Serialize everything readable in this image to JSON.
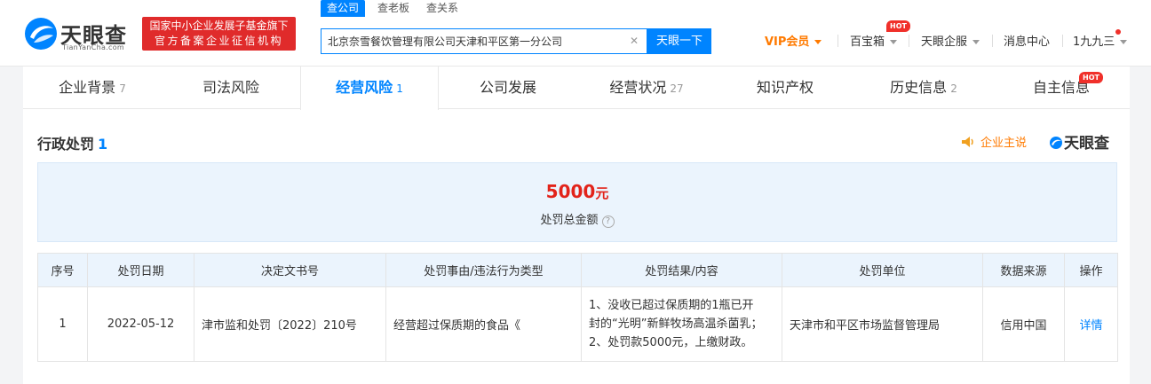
{
  "header": {
    "logo_text": "天眼查",
    "logo_domain": "TianYanCha.com",
    "gov_line1": "国家中小企业发展子基金旗下",
    "gov_line2": "官方备案企业征信机构",
    "search_tabs": [
      "查公司",
      "查老板",
      "查关系"
    ],
    "search_value": "北京奈雪餐饮管理有限公司天津和平区第一分公司",
    "search_button": "天眼一下",
    "vip_label": "VIP会员",
    "nav": {
      "treasure": "百宝箱",
      "enterprise": "天眼企服",
      "messages": "消息中心",
      "user": "1九九三"
    },
    "hot_badge": "HOT"
  },
  "tabs": [
    {
      "label": "企业背景",
      "count": "7"
    },
    {
      "label": "司法风险",
      "count": ""
    },
    {
      "label": "经营风险",
      "count": "1"
    },
    {
      "label": "公司发展",
      "count": ""
    },
    {
      "label": "经营状况",
      "count": "27"
    },
    {
      "label": "知识产权",
      "count": ""
    },
    {
      "label": "历史信息",
      "count": "2"
    },
    {
      "label": "自主信息",
      "count": ""
    }
  ],
  "section": {
    "title": "行政处罚",
    "count": "1",
    "owner_link": "企业主说",
    "brand_mark": "天眼查"
  },
  "summary": {
    "amount": "5000",
    "unit": "元",
    "label": "处罚总金额"
  },
  "table": {
    "columns": [
      "序号",
      "处罚日期",
      "决定文书号",
      "处罚事由/违法行为类型",
      "处罚结果/内容",
      "处罚单位",
      "数据来源",
      "操作"
    ],
    "rows": [
      {
        "index": "1",
        "date": "2022-05-12",
        "doc_no": "津市监和处罚〔2022〕210号",
        "reason": "经营超过保质期的食品《",
        "result_line1": "1、没收已超过保质期的1瓶已开",
        "result_line2": "封的“光明”新鲜牧场高温杀菌乳；",
        "result_line3": "2、处罚款5000元，上缴财政。",
        "authority": "天津市和平区市场监督管理局",
        "source": "信用中国",
        "action": "详情"
      }
    ]
  },
  "colors": {
    "accent": "#0084ff",
    "amount": "#e2231a",
    "vip": "#ff7a00",
    "gov_badge": "#e02b2b"
  }
}
